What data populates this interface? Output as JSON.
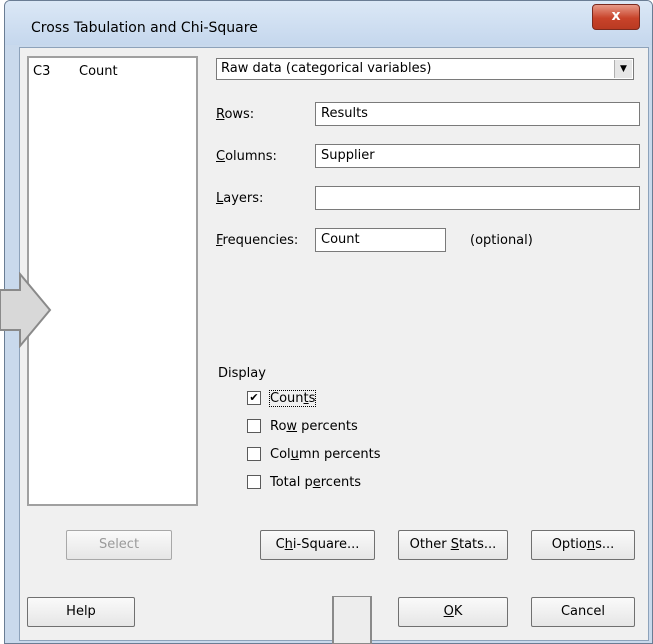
{
  "window": {
    "title": "Cross Tabulation and Chi-Square",
    "close_glyph": "x"
  },
  "variables": [
    {
      "column": "C3",
      "name": "Count"
    }
  ],
  "data_format": {
    "selected": "Raw data (categorical variables)"
  },
  "fields": {
    "rows_label": "Rows:",
    "rows_value": "Results",
    "columns_label": "Columns:",
    "columns_value": "Supplier",
    "layers_label": "Layers:",
    "layers_value": "",
    "frequencies_label": "Frequencies:",
    "frequencies_value": "Count",
    "optional_text": "(optional)"
  },
  "display": {
    "heading": "Display",
    "options": [
      {
        "label": "Counts",
        "checked": true
      },
      {
        "label": "Row percents",
        "checked": false
      },
      {
        "label": "Column percents",
        "checked": false
      },
      {
        "label": "Total percents",
        "checked": false
      }
    ]
  },
  "buttons": {
    "select": "Select",
    "chi_square": "Chi-Square...",
    "other_stats": "Other Stats...",
    "options": "Options...",
    "help": "Help",
    "ok": "OK",
    "cancel": "Cancel"
  },
  "colors": {
    "titlebar": "#c9d9ec",
    "close_button": "#c8432a",
    "dialog_face": "#f0f0f0"
  }
}
